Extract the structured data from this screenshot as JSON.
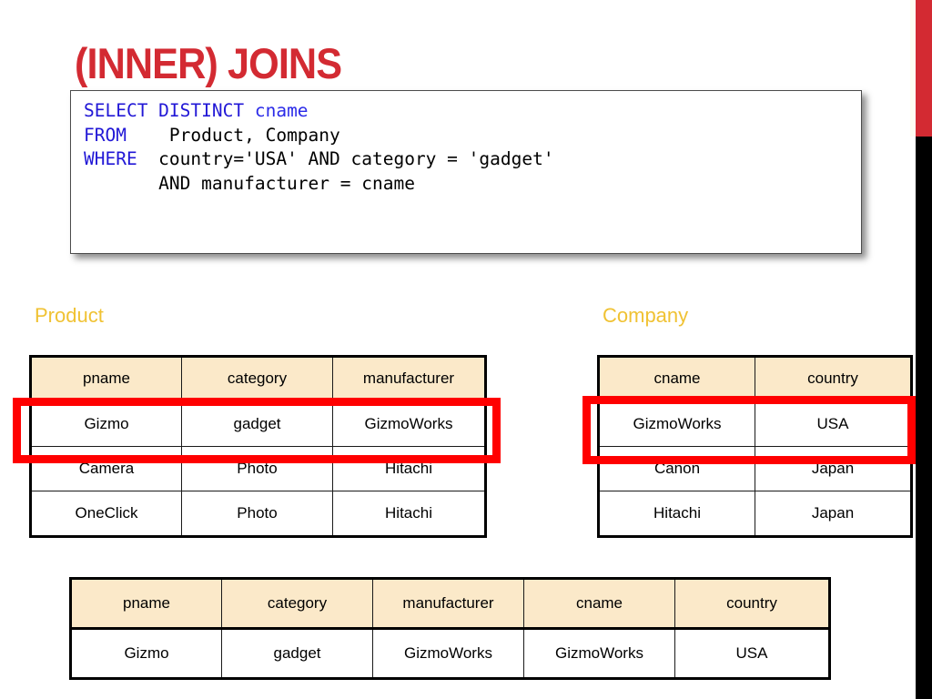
{
  "slide": {
    "title": "(INNER) JOINS"
  },
  "sql": {
    "lines": [
      [
        {
          "text": "SELECT DISTINCT ",
          "style": "kw"
        },
        {
          "text": "cname",
          "style": "kw2"
        }
      ],
      [
        {
          "text": "FROM",
          "style": "kw"
        },
        {
          "text": "    Product, Company",
          "style": "plain"
        }
      ],
      [
        {
          "text": "WHERE",
          "style": "kw"
        },
        {
          "text": "  country='USA' AND category = 'gadget'",
          "style": "plain"
        }
      ],
      [
        {
          "text": "       AND manufacturer = cname",
          "style": "plain"
        }
      ]
    ],
    "plain_text": "SELECT DISTINCT cname\nFROM    Product, Company\nWHERE   country='USA' AND category = 'gadget'\n        AND manufacturer = cname"
  },
  "tables": {
    "product": {
      "caption": "Product",
      "columns": [
        "pname",
        "category",
        "manufacturer"
      ],
      "rows": [
        [
          "Gizmo",
          "gadget",
          "GizmoWorks"
        ],
        [
          "Camera",
          "Photo",
          "Hitachi"
        ],
        [
          "OneClick",
          "Photo",
          "Hitachi"
        ]
      ],
      "highlighted_row_index": 0
    },
    "company": {
      "caption": "Company",
      "columns": [
        "cname",
        "country"
      ],
      "rows": [
        [
          "GizmoWorks",
          "USA"
        ],
        [
          "Canon",
          "Japan"
        ],
        [
          "Hitachi",
          "Japan"
        ]
      ],
      "highlighted_row_index": 0
    },
    "result": {
      "caption": "",
      "columns": [
        "pname",
        "category",
        "manufacturer",
        "cname",
        "country"
      ],
      "rows": [
        [
          "Gizmo",
          "gadget",
          "GizmoWorks",
          "GizmoWorks",
          "USA"
        ]
      ]
    }
  },
  "colors": {
    "title_red": "#D32A32",
    "caption_gold": "#F0C233",
    "header_cell_bg": "#FBE9C9",
    "highlight_red": "#FF0000",
    "keyword_blue": "#2117D6",
    "band_red": "#D32A32",
    "band_black": "#000000",
    "band_cream": "#FFFDF2"
  }
}
